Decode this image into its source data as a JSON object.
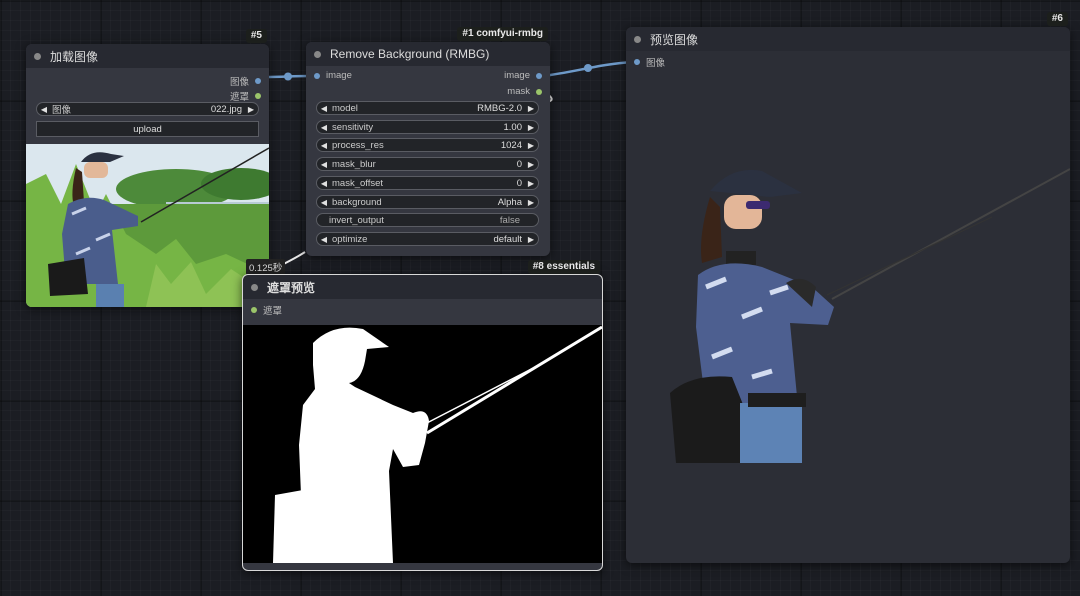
{
  "nodes": {
    "load_image": {
      "badge": "#5",
      "title": "加载图像",
      "outputs": [
        "图像",
        "遮罩"
      ],
      "image_widget": {
        "label": "图像",
        "value": "022.jpg"
      },
      "upload_label": "upload"
    },
    "rmbg": {
      "badge": "#1 comfyui-rmbg",
      "title": "Remove Background (RMBG)",
      "input": "image",
      "outputs": [
        "image",
        "mask"
      ],
      "widgets": [
        {
          "label": "model",
          "value": "RMBG-2.0"
        },
        {
          "label": "sensitivity",
          "value": "1.00"
        },
        {
          "label": "process_res",
          "value": "1024"
        },
        {
          "label": "mask_blur",
          "value": "0"
        },
        {
          "label": "mask_offset",
          "value": "0"
        },
        {
          "label": "background",
          "value": "Alpha"
        },
        {
          "label": "invert_output",
          "value": "false"
        },
        {
          "label": "optimize",
          "value": "default"
        }
      ],
      "timing": "0.125秒"
    },
    "mask_preview": {
      "badge": "#8 essentials",
      "title": "遮罩预览",
      "input": "遮罩"
    },
    "preview_image": {
      "badge": "#6",
      "title": "预览图像",
      "input": "图像"
    }
  },
  "colors": {
    "image_link": "#6e9ac9",
    "mask_link": "#9bc56a",
    "canvas": "#1b1d23",
    "node_body": "#353740",
    "node_header": "#272931"
  }
}
